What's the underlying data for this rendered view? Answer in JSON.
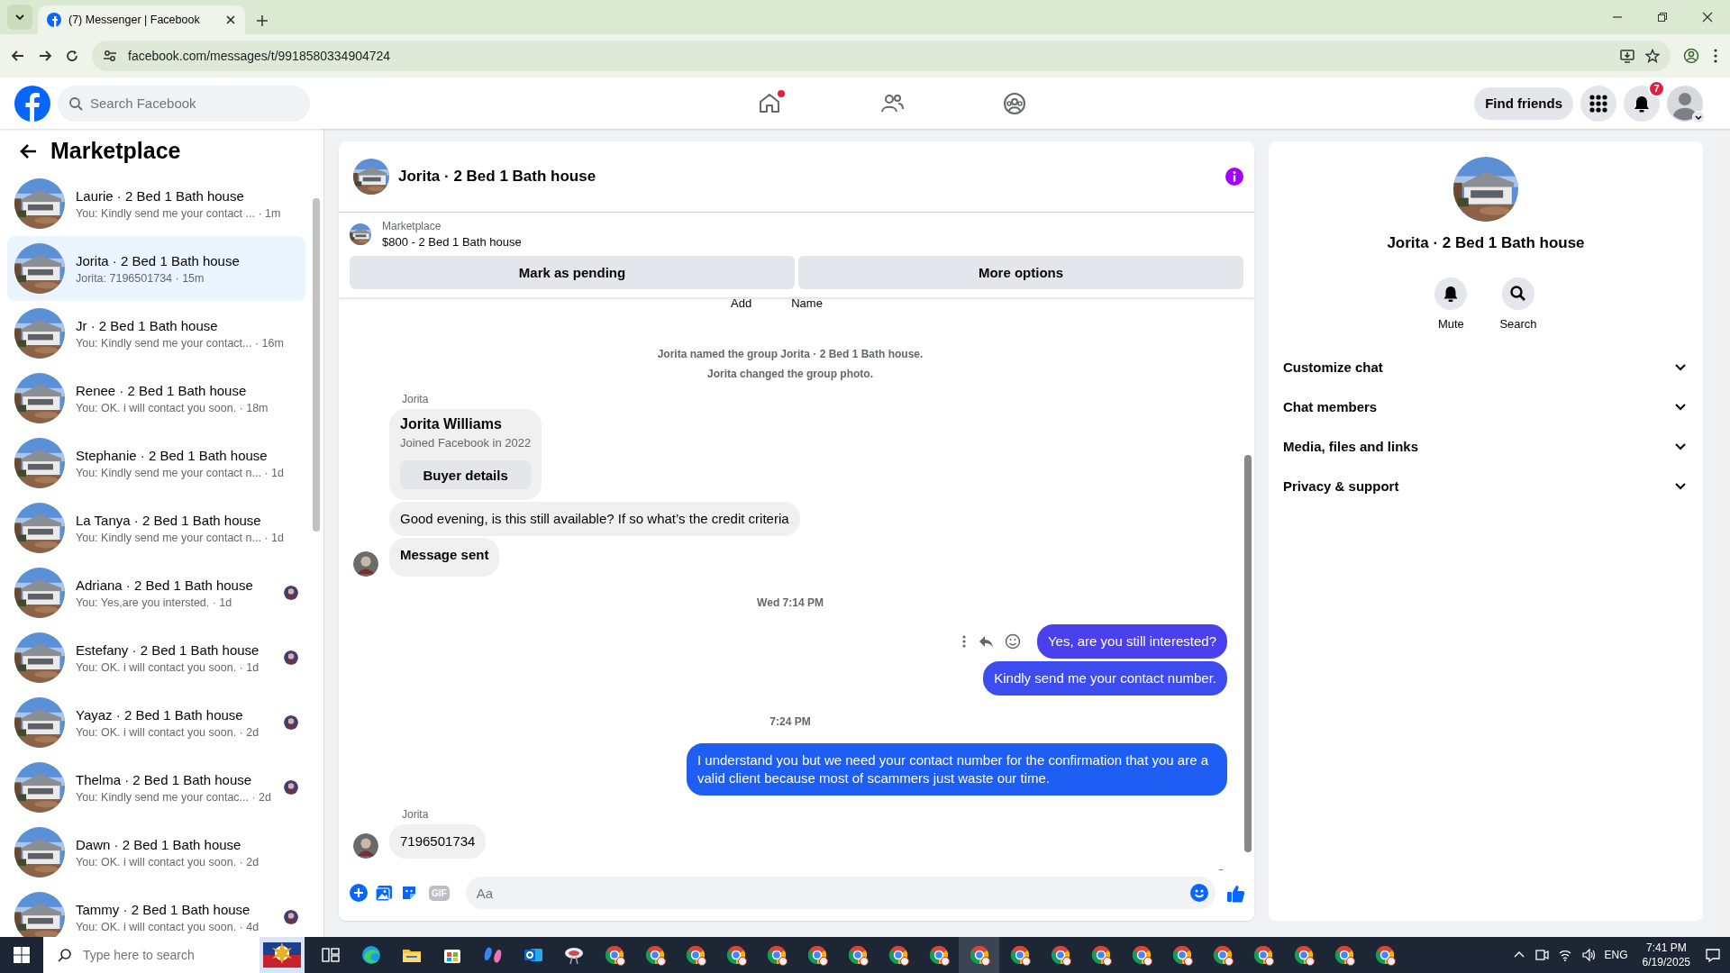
{
  "browser": {
    "tab_title": "(7) Messenger | Facebook",
    "url": "facebook.com/messages/t/9918580334904724"
  },
  "header": {
    "search_placeholder": "Search Facebook",
    "find_friends": "Find friends",
    "notification_count": "7",
    "home_dot": true
  },
  "sidebar": {
    "title": "Marketplace",
    "conversations": [
      {
        "title": "Laurie · 2 Bed 1 Bath house",
        "preview": "You: Kindly send me your contact ...  · 1m",
        "selected": false,
        "seen": false
      },
      {
        "title": "Jorita · 2 Bed 1 Bath house",
        "preview": "Jorita: 7196501734 · 15m",
        "selected": true,
        "seen": false
      },
      {
        "title": "Jr · 2 Bed 1 Bath house",
        "preview": "You: Kindly send me your contact... · 16m",
        "selected": false,
        "seen": false
      },
      {
        "title": "Renee · 2 Bed 1 Bath house",
        "preview": "You: OK. i will contact you soon. · 18m",
        "selected": false,
        "seen": false
      },
      {
        "title": "Stephanie · 2 Bed 1 Bath house",
        "preview": "You: Kindly send me your contact n... · 1d",
        "selected": false,
        "seen": false
      },
      {
        "title": "La Tanya · 2 Bed 1 Bath house",
        "preview": "You: Kindly send me your contact n... · 1d",
        "selected": false,
        "seen": false
      },
      {
        "title": "Adriana · 2 Bed 1 Bath house",
        "preview": "You: Yes,are you intersted. · 1d",
        "selected": false,
        "seen": true
      },
      {
        "title": "Estefany · 2 Bed 1 Bath house",
        "preview": "You: OK. i will contact you soon. · 1d",
        "selected": false,
        "seen": true
      },
      {
        "title": "Yayaz · 2 Bed 1 Bath house",
        "preview": "You: OK. i will contact you soon. · 2d",
        "selected": false,
        "seen": true
      },
      {
        "title": "Thelma · 2 Bed 1 Bath house",
        "preview": "You: Kindly send me your contac... · 2d",
        "selected": false,
        "seen": true
      },
      {
        "title": "Dawn · 2 Bed 1 Bath house",
        "preview": "You: OK. i will contact you soon. · 2d",
        "selected": false,
        "seen": false
      },
      {
        "title": "Tammy · 2 Bed 1 Bath house",
        "preview": "You: OK. i will contact you soon. · 4d",
        "selected": false,
        "seen": true
      }
    ]
  },
  "chat": {
    "title": "Jorita · 2 Bed 1 Bath house",
    "listing": {
      "label": "Marketplace",
      "title": "$800 - 2 Bed 1 Bath house"
    },
    "actions": [
      "Mark as pending",
      "More options"
    ],
    "top_labels": [
      "Add",
      "Name"
    ],
    "messages": [
      {
        "kind": "system",
        "text": "Jorita named the group Jorita · 2 Bed 1 Bath house."
      },
      {
        "kind": "system",
        "text": "Jorita changed the group photo."
      },
      {
        "kind": "sender",
        "text": "Jorita"
      },
      {
        "kind": "card",
        "name": "Jorita Williams",
        "subtitle": "Joined Facebook in 2022",
        "button": "Buyer details"
      },
      {
        "kind": "incoming",
        "text": "Good evening, is this still available? If so what’s the credit criteria",
        "bold": false,
        "avatar": false
      },
      {
        "kind": "incoming",
        "text": "Message sent",
        "bold": true,
        "avatar": true
      },
      {
        "kind": "time",
        "text": "Wed 7:14 PM"
      },
      {
        "kind": "outgoing",
        "text": "Yes, are you still interested?",
        "color": "#4a40ee",
        "hover_actions": true
      },
      {
        "kind": "outgoing",
        "text": "Kindly send me your contact number.",
        "color": "#3c4cef",
        "hover_actions": false
      },
      {
        "kind": "time",
        "text": "7:24 PM"
      },
      {
        "kind": "outgoing",
        "text": "I  understand you  but we need your contact number for the confirmation that you are a valid client because most of scammers just waste our time.",
        "color": "#1e5ef2",
        "hover_actions": false
      },
      {
        "kind": "sender",
        "text": "Jorita"
      },
      {
        "kind": "incoming",
        "text": "7196501734",
        "bold": false,
        "avatar": true
      },
      {
        "kind": "seen"
      }
    ],
    "composer": {
      "placeholder": "Aa",
      "gif_label": "GIF"
    }
  },
  "details": {
    "title": "Jorita · 2 Bed 1 Bath house",
    "actions": [
      {
        "kind": "mute",
        "label": "Mute"
      },
      {
        "kind": "search",
        "label": "Search"
      }
    ],
    "sections": [
      {
        "label": "Customize chat",
        "expanded": false
      },
      {
        "label": "Chat members",
        "expanded": false
      },
      {
        "label": "Media, files and links",
        "expanded": false
      },
      {
        "label": "Privacy & support",
        "expanded": false
      }
    ]
  },
  "taskbar": {
    "search_placeholder": "Type here to search",
    "language": "ENG",
    "time": "7:41 PM",
    "date": "6/19/2025"
  }
}
